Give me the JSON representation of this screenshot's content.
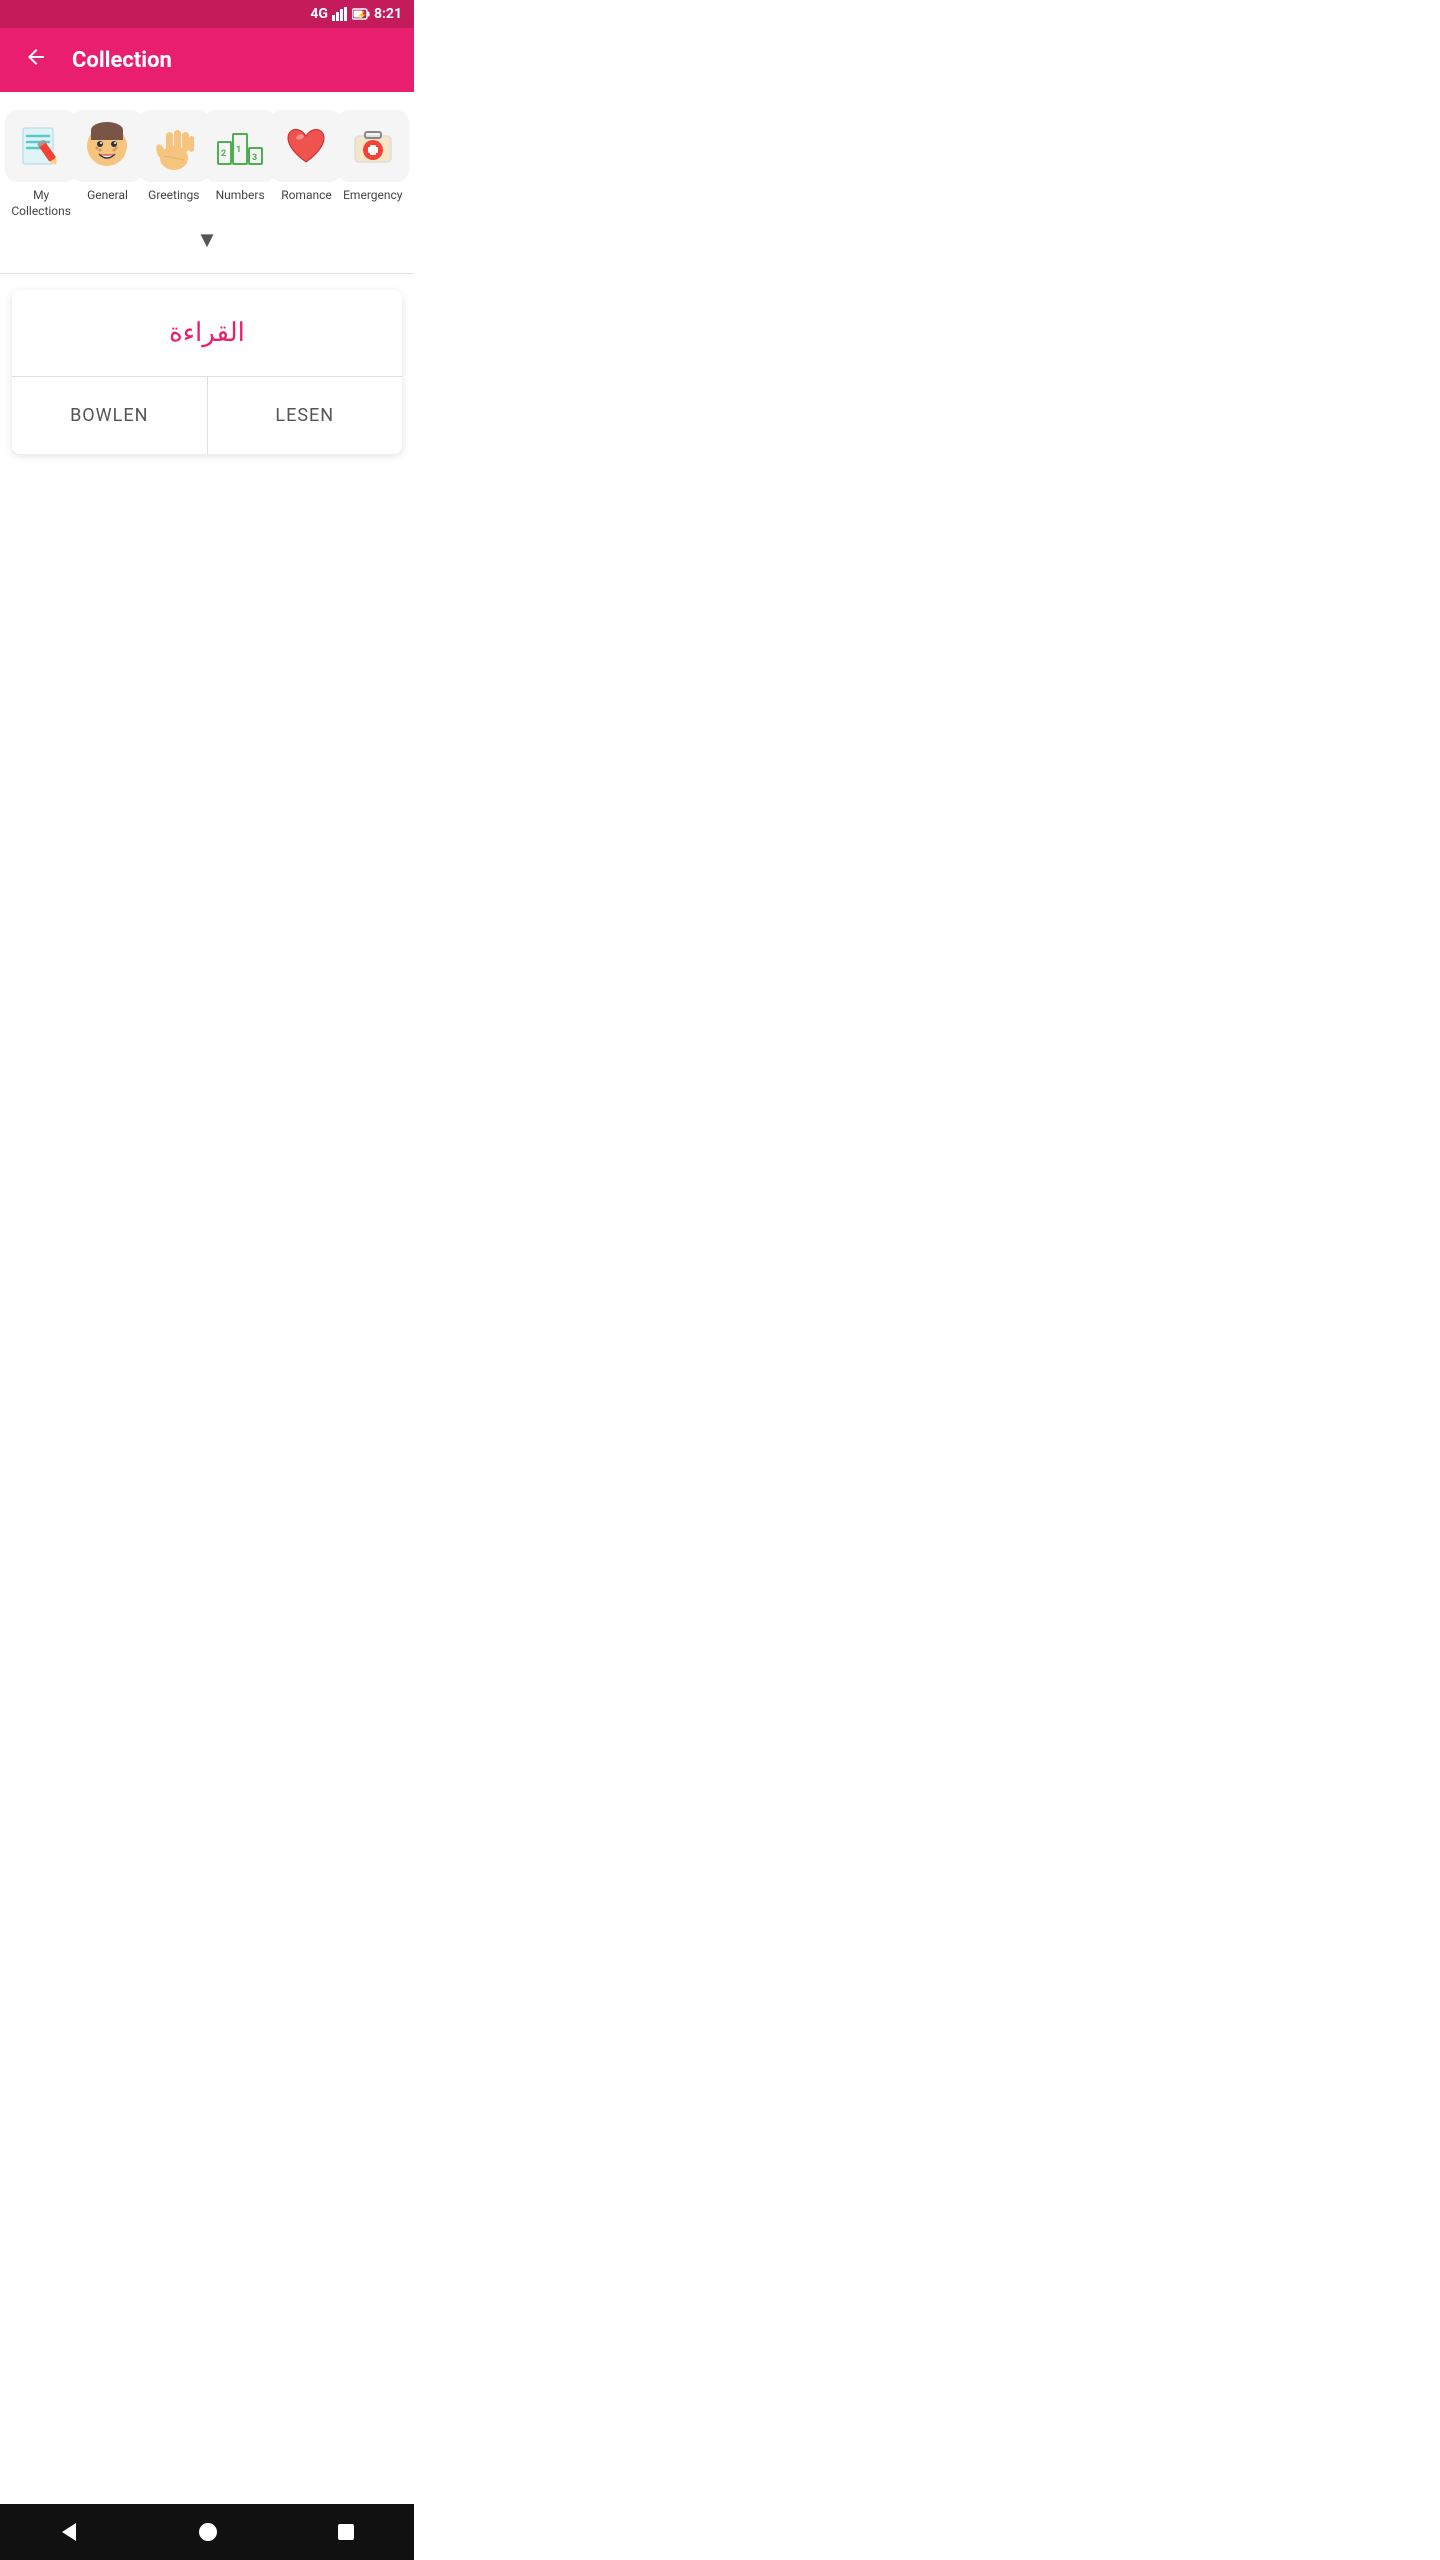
{
  "statusBar": {
    "signal": "4G",
    "time": "8:21",
    "batteryIcon": "🔋"
  },
  "appBar": {
    "title": "Collection",
    "backLabel": "←"
  },
  "categories": [
    {
      "id": "my-collections",
      "label": "My Collections",
      "icon": "pencil-notebook"
    },
    {
      "id": "general",
      "label": "General",
      "icon": "emoji-face"
    },
    {
      "id": "greetings",
      "label": "Greetings",
      "icon": "wave-hand"
    },
    {
      "id": "numbers",
      "label": "Numbers",
      "icon": "numbers-podium"
    },
    {
      "id": "romance",
      "label": "Romance",
      "icon": "heart"
    },
    {
      "id": "emergency",
      "label": "Emergency",
      "icon": "first-aid"
    }
  ],
  "chevron": "▼",
  "card": {
    "arabicText": "القراءة",
    "translation1": "BOWLEN",
    "translation2": "LESEN"
  },
  "bottomNav": {
    "back": "◀",
    "home": "●",
    "square": "■"
  }
}
